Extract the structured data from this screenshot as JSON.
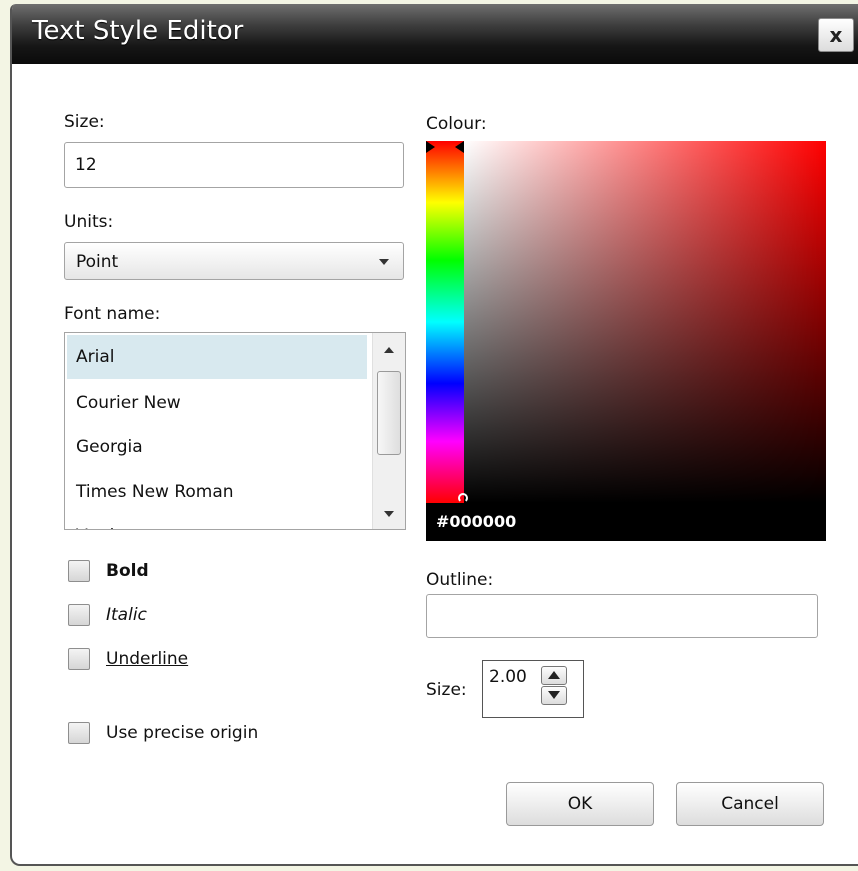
{
  "dialog": {
    "title": "Text Style Editor",
    "close_label": "x"
  },
  "size": {
    "label": "Size:",
    "value": "12"
  },
  "units": {
    "label": "Units:",
    "selected": "Point"
  },
  "font": {
    "label": "Font name:",
    "items": [
      "Arial",
      "Courier New",
      "Georgia",
      "Times New Roman",
      "Verdana"
    ],
    "selected_index": 0
  },
  "styles": {
    "bold_label": "Bold",
    "italic_label": "Italic",
    "underline_label": "Underline",
    "bold_checked": false,
    "italic_checked": false,
    "underline_checked": false
  },
  "origin": {
    "label": "Use precise origin",
    "checked": false
  },
  "colour": {
    "label": "Colour:",
    "hex": "#000000",
    "hue_color": "#ff0000"
  },
  "outline": {
    "label": "Outline:",
    "value": "",
    "size_label": "Size:",
    "size_value": "2.00"
  },
  "buttons": {
    "ok_label": "OK",
    "cancel_label": "Cancel"
  }
}
